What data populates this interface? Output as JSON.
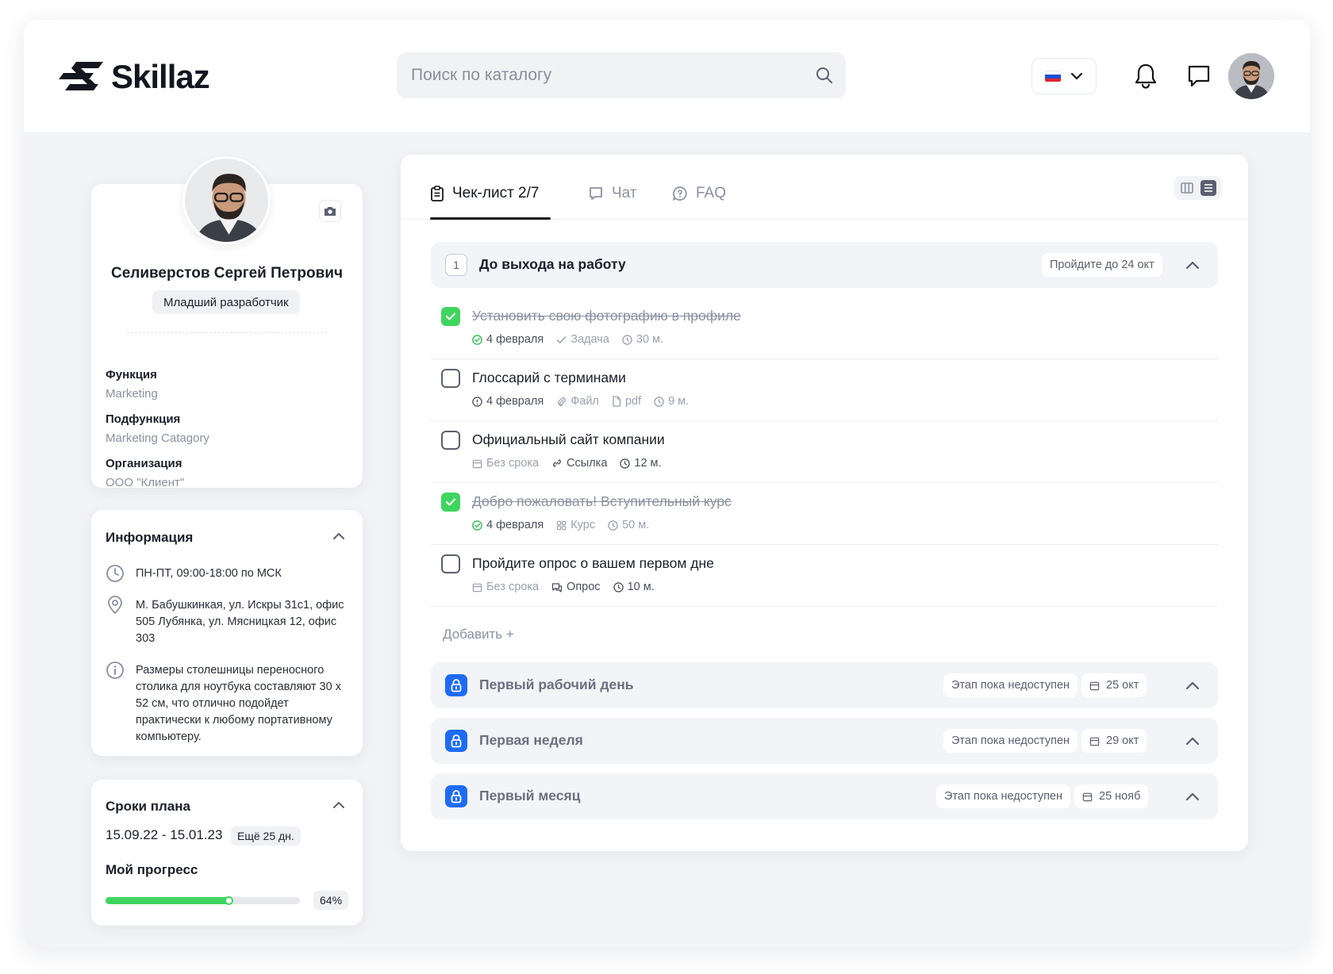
{
  "header": {
    "logo_text": "Skillaz",
    "search_placeholder": "Поиск по каталогу",
    "language": "ru"
  },
  "profile": {
    "name": "Селиверстов Сергей Петрович",
    "role": "Младший разработчик",
    "fields": [
      {
        "label": "Функция",
        "value": "Marketing"
      },
      {
        "label": "Подфункция",
        "value": "Marketing Catagory"
      },
      {
        "label": "Организация",
        "value": "ООО \"Клиент\""
      }
    ]
  },
  "info": {
    "title": "Информация",
    "items": [
      {
        "icon": "clock-icon",
        "text": "ПН-ПТ, 09:00-18:00 по МСК"
      },
      {
        "icon": "location-pin-icon",
        "text": "М. Бабушкинкая, ул. Искры 31с1, офис 505 Лубянка, ул. Мясницкая 12, офис 303"
      },
      {
        "icon": "info-icon",
        "text": "Размеры столешницы переносного столика для ноутбука составляют 30 х 52 см, что отлично подойдет практически к любому портативному компьютеру."
      }
    ]
  },
  "plan": {
    "title": "Сроки плана",
    "dates": "15.09.22 - 15.01.23",
    "remaining": "Ещё 25 дн.",
    "progress_title": "Мой прогресс",
    "progress_label": "64%",
    "progress_value": 0.64
  },
  "tabs": [
    {
      "label": "Чек-лист 2/7",
      "icon": "checklist-icon",
      "active": true
    },
    {
      "label": "Чат",
      "icon": "chat-icon",
      "active": false
    },
    {
      "label": "FAQ",
      "icon": "faq-icon",
      "active": false
    }
  ],
  "stage1": {
    "number": "1",
    "title": "До выхода на работу",
    "deadline": "Пройдите до 24 окт"
  },
  "tasks": [
    {
      "title": "Установить свою фотографию в профиле",
      "done": true,
      "date": "4 февраля",
      "type": "Задача",
      "duration": "30 м."
    },
    {
      "title": "Глоссарий с терминами",
      "done": false,
      "date": "4 февраля",
      "type": "Файл",
      "format": "pdf",
      "duration": "9 м."
    },
    {
      "title": "Официальный сайт компании",
      "done": false,
      "date": "Без срока",
      "type": "Ссылка",
      "duration": "12 м."
    },
    {
      "title": "Добро пожаловать! Вступительный курс",
      "done": true,
      "date": "4 февраля",
      "type": "Курс",
      "duration": "50 м."
    },
    {
      "title": "Пройдите опрос о вашем первом дне",
      "done": false,
      "date": "Без срока",
      "type": "Опрос",
      "duration": "10 м."
    }
  ],
  "add_label": "Добавить +",
  "locked_stages": [
    {
      "title": "Первый рабочий день",
      "status": "Этап пока недоступен",
      "date": "25 окт"
    },
    {
      "title": "Первая неделя",
      "status": "Этап пока недоступен",
      "date": "29 окт"
    },
    {
      "title": "Первый месяц",
      "status": "Этап пока недоступен",
      "date": "25 нояб"
    }
  ],
  "colors": {
    "accent_green": "#3fd55f",
    "accent_blue": "#1e6bf5",
    "background": "#f1f3f6"
  }
}
